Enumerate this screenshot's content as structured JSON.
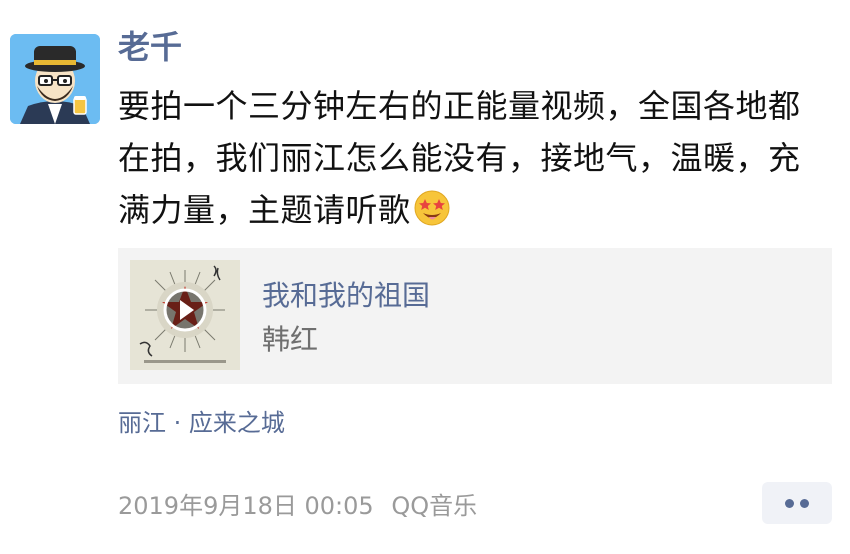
{
  "post": {
    "author": "老千",
    "text": "要拍一个三分钟左右的正能量视频，全国各地都在拍，我们丽江怎么能没有，接地气，温暖，充满力量，主题请听歌",
    "emoji_icon": "star-struck-emoji-icon"
  },
  "music": {
    "title": "我和我的祖国",
    "artist": "韩红",
    "cover_icon": "album-cover-red-star-play-icon"
  },
  "location": "丽江 · 应来之城",
  "meta": {
    "timestamp": "2019年9月18日 00:05",
    "source": "QQ音乐"
  },
  "colors": {
    "link": "#576b95",
    "meta_gray": "#9a9a9a",
    "card_bg": "#f3f3f3"
  }
}
